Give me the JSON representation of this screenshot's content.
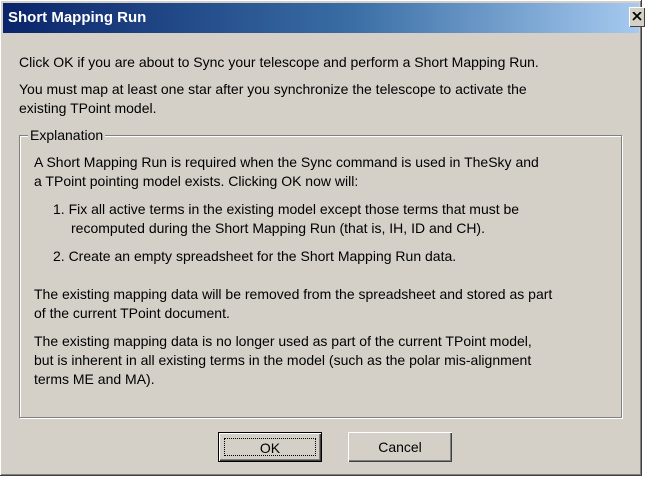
{
  "window": {
    "title": "Short Mapping Run",
    "close_icon": "close-icon"
  },
  "intro": {
    "line1": "Click OK if you are about to Sync your telescope and perform a Short Mapping Run.",
    "line2": "You must map at least one star after you synchronize the telescope to activate the",
    "line3": "existing TPoint model."
  },
  "explanation": {
    "legend": "Explanation",
    "para1_line1": "A Short Mapping Run is required when the Sync command is used in TheSky and",
    "para1_line2": "a TPoint pointing model exists. Clicking OK now will:",
    "item1_line1": "1. Fix all active terms in the existing model except those terms that must be",
    "item1_line2": "recomputed during the Short Mapping Run (that is, IH, ID and CH).",
    "item2": "2. Create an empty spreadsheet for the Short Mapping Run data.",
    "para2_line1": "The existing mapping data will be removed from the spreadsheet and stored as part",
    "para2_line2": "of the current TPoint document.",
    "para3_line1": "The existing mapping data is no longer used as part of the current TPoint model,",
    "para3_line2": "but is inherent in all existing terms in the model (such as the polar mis-alignment",
    "para3_line3": "terms ME and MA)."
  },
  "buttons": {
    "ok": "OK",
    "cancel": "Cancel"
  }
}
